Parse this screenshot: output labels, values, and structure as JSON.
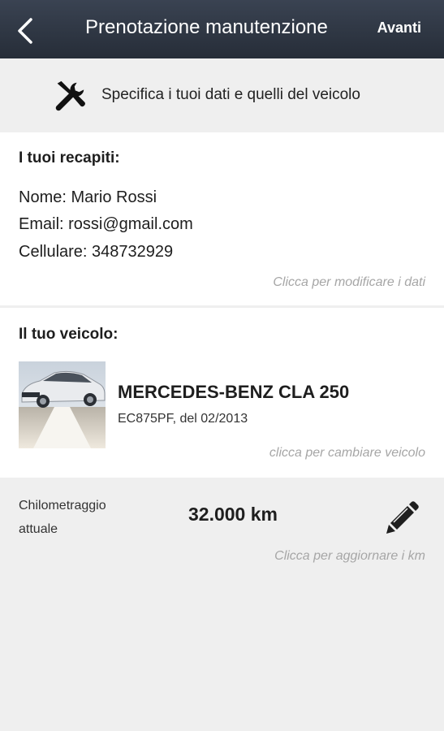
{
  "header": {
    "title": "Prenotazione manutenzione",
    "action_label": "Avanti"
  },
  "intro": {
    "text": "Specifica i tuoi dati e quelli del veicolo"
  },
  "contacts": {
    "heading": "I tuoi recapiti:",
    "name_line": "Nome: Mario Rossi",
    "email_line": "Email: rossi@gmail.com",
    "phone_line": "Cellulare: 348732929",
    "hint": "Clicca per modificare i dati"
  },
  "vehicle": {
    "heading": "Il tuo veicolo:",
    "model": "MERCEDES-BENZ CLA 250",
    "detail": "EC875PF, del 02/2013",
    "hint": "clicca per cambiare veicolo"
  },
  "mileage": {
    "label": "Chilometraggio attuale",
    "value": "32.000 km",
    "hint": "Clicca per aggiornare i km"
  },
  "icons": {
    "back": "chevron-left-icon",
    "tools": "tools-icon",
    "edit": "pencil-icon",
    "vehicle": "car-photo"
  },
  "colors": {
    "appbar": "#2f3744",
    "background": "#efefef",
    "card": "#ffffff",
    "hint": "#a6a6a6"
  }
}
